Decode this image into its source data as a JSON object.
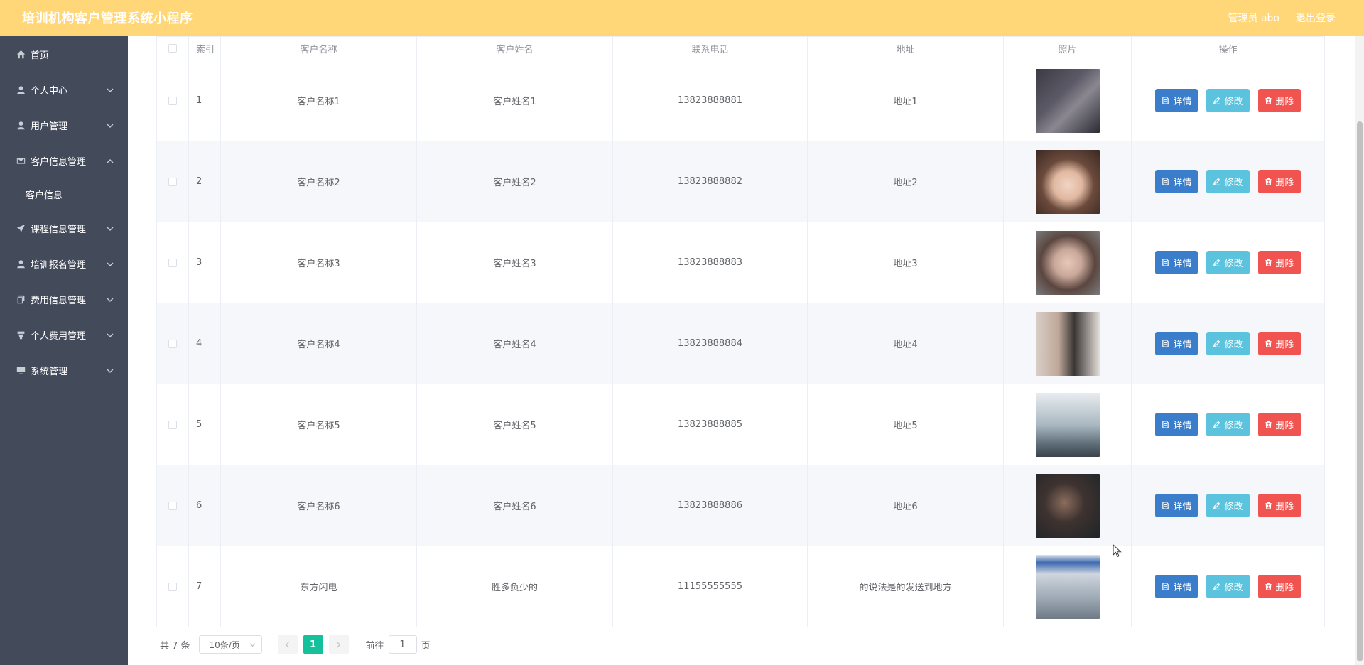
{
  "header": {
    "title": "培训机构客户管理系统小程序",
    "admin_label": "管理员 abo",
    "logout_label": "退出登录"
  },
  "sidebar": {
    "items": [
      {
        "label": "首页",
        "icon": "home-icon",
        "has_children": false
      },
      {
        "label": "个人中心",
        "icon": "user-icon",
        "has_children": true
      },
      {
        "label": "用户管理",
        "icon": "user-icon",
        "has_children": true
      },
      {
        "label": "客户信息管理",
        "icon": "mail-icon",
        "has_children": true,
        "expanded": true,
        "children": [
          {
            "label": "客户信息"
          }
        ]
      },
      {
        "label": "课程信息管理",
        "icon": "send-icon",
        "has_children": true
      },
      {
        "label": "培训报名管理",
        "icon": "user-icon",
        "has_children": true
      },
      {
        "label": "费用信息管理",
        "icon": "copy-icon",
        "has_children": true
      },
      {
        "label": "个人费用管理",
        "icon": "cup-icon",
        "has_children": true
      },
      {
        "label": "系统管理",
        "icon": "monitor-icon",
        "has_children": true
      }
    ]
  },
  "table": {
    "headers": {
      "index": "索引",
      "name": "客户名称",
      "person": "客户姓名",
      "phone": "联系电话",
      "address": "地址",
      "photo": "照片",
      "actions": "操作"
    },
    "rows": [
      {
        "index": "1",
        "name": "客户名称1",
        "person": "客户姓名1",
        "phone": "13823888881",
        "address": "地址1"
      },
      {
        "index": "2",
        "name": "客户名称2",
        "person": "客户姓名2",
        "phone": "13823888882",
        "address": "地址2"
      },
      {
        "index": "3",
        "name": "客户名称3",
        "person": "客户姓名3",
        "phone": "13823888883",
        "address": "地址3"
      },
      {
        "index": "4",
        "name": "客户名称4",
        "person": "客户姓名4",
        "phone": "13823888884",
        "address": "地址4"
      },
      {
        "index": "5",
        "name": "客户名称5",
        "person": "客户姓名5",
        "phone": "13823888885",
        "address": "地址5"
      },
      {
        "index": "6",
        "name": "客户名称6",
        "person": "客户姓名6",
        "phone": "13823888886",
        "address": "地址6"
      },
      {
        "index": "7",
        "name": "东方闪电",
        "person": "胜多负少的",
        "phone": "11155555555",
        "address": "的说法是的发送到地方"
      }
    ],
    "actions": {
      "detail": "详情",
      "edit": "修改",
      "delete": "删除"
    }
  },
  "pagination": {
    "total": "共 7 条",
    "page_size": "10条/页",
    "current_page": "1",
    "goto_prefix": "前往",
    "goto_value": "1",
    "goto_suffix": "页"
  },
  "colors": {
    "header_bg": "#FFD778",
    "sidebar_bg": "#434A5A",
    "detail_btn": "#3A7DCB",
    "edit_btn": "#5BC3DE",
    "delete_btn": "#F15450",
    "page_active": "#15C19A"
  }
}
